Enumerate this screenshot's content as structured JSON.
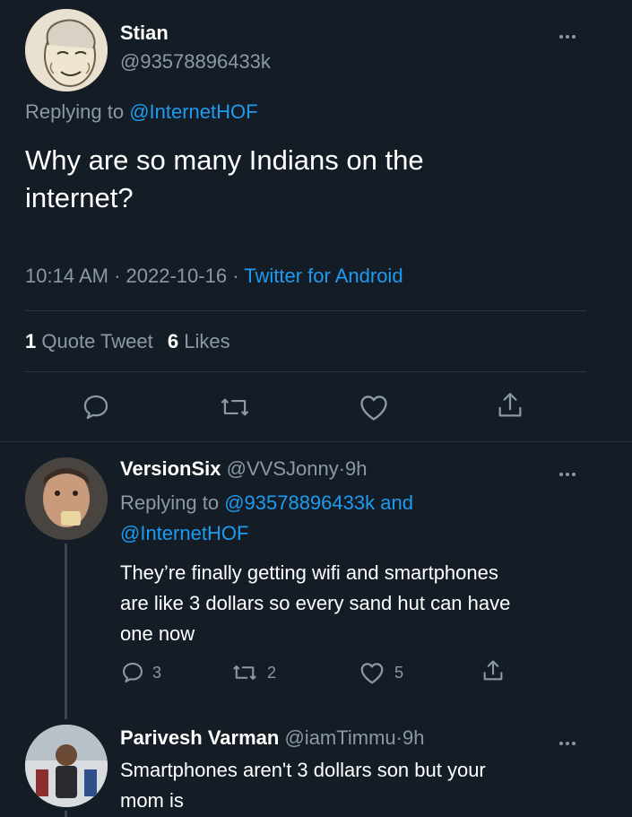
{
  "main_tweet": {
    "display_name": "Stian",
    "handle": "@93578896433k",
    "replying_prefix": "Replying to ",
    "replying_to": "@InternetHOF",
    "text_line1": "Why are so many Indians on the",
    "text_line2": "internet?",
    "time": "10:14 AM",
    "date": "2022-10-16",
    "source": "Twitter for Android",
    "quote_count": "1",
    "quote_label": "Quote Tweet",
    "like_count": "6",
    "like_label": "Likes"
  },
  "replies": [
    {
      "display_name": "VersionSix",
      "handle": "@VVSJonny",
      "time": "9h",
      "replying_prefix": "Replying to ",
      "replying_to_1": "@93578896433k",
      "replying_and": " and",
      "replying_to_2": "@InternetHOF",
      "text_line1": "They’re finally getting wifi and smartphones",
      "text_line2": "are like 3 dollars so every sand hut can have",
      "text_line3": "one now",
      "reply_count": "3",
      "retweet_count": "2",
      "like_count": "5"
    },
    {
      "display_name": "Parivesh Varman",
      "handle": "@iamTimmu",
      "time": "9h",
      "text_line1": "Smartphones aren't 3 dollars son but your",
      "text_line2": "mom is"
    }
  ],
  "separator": "·",
  "icons": {
    "more": "more-horizontal-icon",
    "reply": "reply-icon",
    "retweet": "retweet-icon",
    "like": "heart-icon",
    "share": "share-icon"
  },
  "colors": {
    "background": "#141d26",
    "text": "#ffffff",
    "muted": "#8b98a5",
    "accent": "#1d9bf0",
    "divider": "#2b3640"
  }
}
